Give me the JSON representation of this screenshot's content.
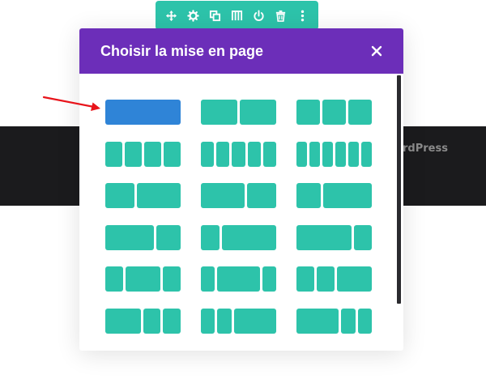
{
  "background_band": {
    "text": "rdPress"
  },
  "toolbar": {
    "icons": [
      "move-icon",
      "gear-icon",
      "duplicate-icon",
      "columns-icon",
      "power-icon",
      "trash-icon",
      "more-icon"
    ]
  },
  "modal": {
    "title": "Choisir la mise en page",
    "close_icon": "close-icon",
    "layouts": [
      {
        "id": "1",
        "columns": [
          "1"
        ],
        "selected": true
      },
      {
        "id": "1-2_1-2",
        "columns": [
          "1/2",
          "1/2"
        ]
      },
      {
        "id": "1-3x3",
        "columns": [
          "1/3",
          "1/3",
          "1/3"
        ]
      },
      {
        "id": "1-4x4",
        "columns": [
          "1/4",
          "1/4",
          "1/4",
          "1/4"
        ]
      },
      {
        "id": "1-5x5",
        "columns": [
          "1/5",
          "1/5",
          "1/5",
          "1/5",
          "1/5"
        ]
      },
      {
        "id": "1-6x6",
        "columns": [
          "1/6",
          "1/6",
          "1/6",
          "1/6",
          "1/6",
          "1/6"
        ]
      },
      {
        "id": "2-5_3-5",
        "columns": [
          "2/5",
          "3/5"
        ]
      },
      {
        "id": "3-5_2-5",
        "columns": [
          "3/5",
          "2/5"
        ]
      },
      {
        "id": "1-3_2-3",
        "columns": [
          "1/3",
          "2/3"
        ]
      },
      {
        "id": "2-3_1-3",
        "columns": [
          "2/3",
          "1/3"
        ]
      },
      {
        "id": "1-4_3-4",
        "columns": [
          "1/4",
          "3/4"
        ]
      },
      {
        "id": "3-4_1-4",
        "columns": [
          "3/4",
          "1/4"
        ]
      },
      {
        "id": "1-4_1-2_1-4",
        "columns": [
          "1/4",
          "1/2",
          "1/4"
        ]
      },
      {
        "id": "1-5_3-5_1-5",
        "columns": [
          "1/5",
          "3/5",
          "1/5"
        ]
      },
      {
        "id": "1-4_1-4_1-2",
        "columns": [
          "1/4",
          "1/4",
          "1/2"
        ]
      },
      {
        "id": "1-2_1-4_1-4",
        "columns": [
          "1/2",
          "1/4",
          "1/4"
        ]
      },
      {
        "id": "1-5_1-5_3-5",
        "columns": [
          "1/5",
          "1/5",
          "3/5"
        ]
      },
      {
        "id": "3-5_1-5_1-5",
        "columns": [
          "3/5",
          "1/5",
          "1/5"
        ]
      }
    ]
  },
  "colors": {
    "toolbar": "#2dc3aa",
    "header": "#6c2eb9",
    "column": "#2dc3aa",
    "selected_column": "#2f84d7",
    "arrow": "#e8141b",
    "band": "#1b1b1d"
  }
}
